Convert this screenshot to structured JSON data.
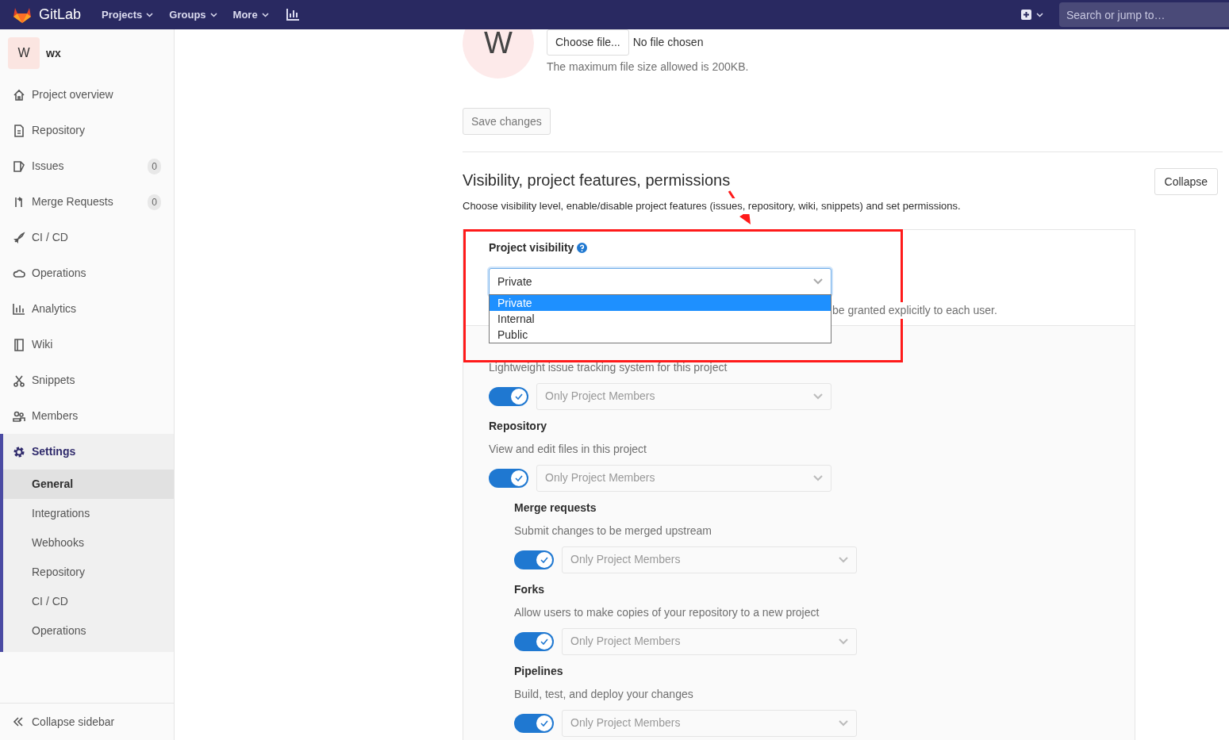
{
  "navbar": {
    "brand": "GitLab",
    "menus": [
      {
        "label": "Projects"
      },
      {
        "label": "Groups"
      },
      {
        "label": "More"
      }
    ],
    "search": {
      "placeholder": "Search or jump to…"
    }
  },
  "sidebar": {
    "project": {
      "avatar": "W",
      "name": "wx"
    },
    "items": [
      {
        "label": "Project overview",
        "selected": false
      },
      {
        "label": "Repository",
        "selected": false
      },
      {
        "label": "Issues",
        "badge": "0",
        "selected": false
      },
      {
        "label": "Merge Requests",
        "badge": "0",
        "selected": false
      },
      {
        "label": "CI / CD",
        "selected": false
      },
      {
        "label": "Operations",
        "selected": false
      },
      {
        "label": "Analytics",
        "selected": false
      },
      {
        "label": "Wiki",
        "selected": false
      },
      {
        "label": "Snippets",
        "selected": false
      },
      {
        "label": "Members",
        "selected": false
      },
      {
        "label": "Settings",
        "selected": true,
        "children": [
          {
            "label": "General",
            "selected": true
          },
          {
            "label": "Integrations",
            "selected": false
          },
          {
            "label": "Webhooks",
            "selected": false
          },
          {
            "label": "Repository",
            "selected": false
          },
          {
            "label": "CI / CD",
            "selected": false
          },
          {
            "label": "Operations",
            "selected": false
          }
        ]
      }
    ],
    "collapse": "Collapse sidebar"
  },
  "avatar_section": {
    "avatar": "W",
    "choose_button": "Choose file...",
    "file_status": "No file chosen",
    "hint": "The maximum file size allowed is 200KB.",
    "save_button": "Save changes"
  },
  "visibility_section": {
    "title": "Visibility, project features, permissions",
    "description": "Choose visibility level, enable/disable project features (issues, repository, wiki, snippets) and set permissions.",
    "collapse_button": "Collapse",
    "visibility": {
      "label": "Project visibility",
      "value": "Private",
      "expanded": true,
      "options": [
        {
          "label": "Private",
          "selected": true
        },
        {
          "label": "Internal",
          "selected": false
        },
        {
          "label": "Public",
          "selected": false
        }
      ],
      "note": "be granted explicitly to each user."
    },
    "features": [
      {
        "description": "Lightweight issue tracking system for this project",
        "on": true,
        "access": "Only Project Members"
      },
      {
        "label": "Repository",
        "description": "View and edit files in this project",
        "on": true,
        "access": "Only Project Members",
        "children": [
          {
            "label": "Merge requests",
            "description": "Submit changes to be merged upstream",
            "on": true,
            "access": "Only Project Members"
          },
          {
            "label": "Forks",
            "description": "Allow users to make copies of your repository to a new project",
            "on": true,
            "access": "Only Project Members"
          },
          {
            "label": "Pipelines",
            "description": "Build, test, and deploy your changes",
            "on": true,
            "access": "Only Project Members"
          }
        ]
      }
    ]
  }
}
